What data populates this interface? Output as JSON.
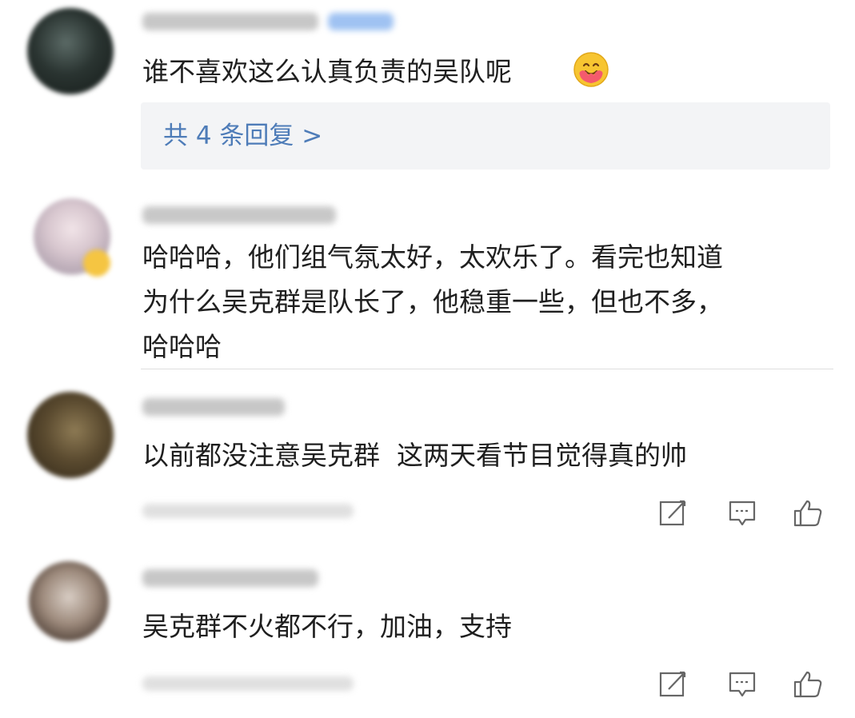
{
  "comments": [
    {
      "text": "谁不喜欢这么认真负责的吴队呢",
      "emoji": "hugging-face-emoji",
      "replies_label": "共 4 条回复 >"
    },
    {
      "text": "哈哈哈，他们组气氛太好，太欢乐了。看完也知道为什么吴克群是队长了，他稳重一些，但也不多，哈哈哈",
      "line1": "哈哈哈，他们组气氛太好，太欢乐了。看完也知道",
      "line2": "为什么吴克群是队长了，他稳重一些，但也不多，",
      "line3": "哈哈哈"
    },
    {
      "text": "以前都没注意吴克群  这两天看节目觉得真的帅",
      "actions": [
        "share-icon",
        "comment-icon",
        "like-icon"
      ]
    },
    {
      "text": "吴克群不火都不行，加油，支持",
      "actions": [
        "share-icon",
        "comment-icon",
        "like-icon"
      ]
    }
  ],
  "colors": {
    "link": "#4e7cb8",
    "reply_bg": "#f3f4f6",
    "text": "#1f1f1f",
    "icon": "#666666"
  }
}
